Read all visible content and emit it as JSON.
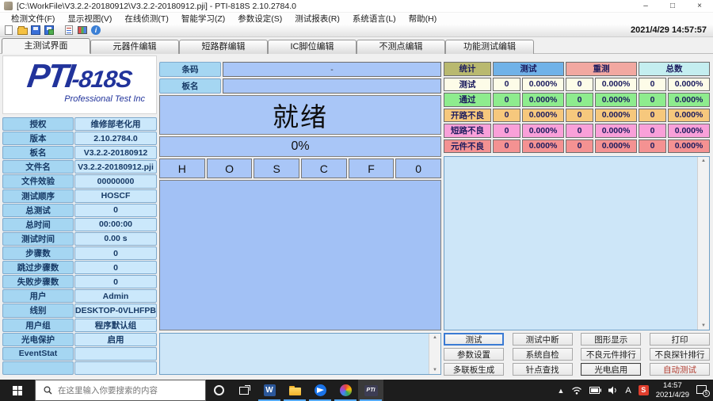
{
  "window": {
    "title": "[C:\\WorkFile\\V3.2.2-20180912\\V3.2.2-20180912.pji] - PTI-818S 2.10.2784.0",
    "controls": {
      "minimize": "–",
      "maximize": "□",
      "close": "×"
    }
  },
  "menu": {
    "items": [
      "检测文件(F)",
      "显示视图(V)",
      "在线侦测(T)",
      "智能学习(Z)",
      "参数设定(S)",
      "测试报表(R)",
      "系统语言(L)",
      "帮助(H)"
    ]
  },
  "toolbar": {
    "icons": [
      "new-file",
      "open-file",
      "save",
      "save-as",
      "report",
      "grid",
      "about"
    ],
    "datetime": "2021/4/29 14:57:57"
  },
  "tabs": [
    "主测试界面",
    "元器件编辑",
    "短路群编辑",
    "IC脚位编辑",
    "不测点编辑",
    "功能测试编辑"
  ],
  "logo": {
    "brand": "PTI",
    "model": "-818S",
    "subtitle": "Professional Test Inc"
  },
  "info_rows": [
    {
      "label": "授权",
      "value": "维修部老化用"
    },
    {
      "label": "版本",
      "value": "2.10.2784.0"
    },
    {
      "label": "板名",
      "value": "V3.2.2-20180912"
    },
    {
      "label": "文件名",
      "value": "V3.2.2-20180912.pji"
    },
    {
      "label": "文件效验",
      "value": "00000000"
    },
    {
      "label": "测试顺序",
      "value": "HOSCF"
    },
    {
      "label": "总测试",
      "value": "0"
    },
    {
      "label": "总时间",
      "value": "00:00:00"
    },
    {
      "label": "测试时间",
      "value": "0.00 s"
    },
    {
      "label": "步骤数",
      "value": "0"
    },
    {
      "label": "跳过步骤数",
      "value": "0"
    },
    {
      "label": "失败步骤数",
      "value": "0"
    },
    {
      "label": "用户",
      "value": "Admin"
    },
    {
      "label": "线别",
      "value": "DESKTOP-0VLHFPB"
    },
    {
      "label": "用户组",
      "value": "程序默认组"
    },
    {
      "label": "光电保护",
      "value": "启用"
    },
    {
      "label": "EventStat",
      "value": ""
    },
    {
      "label": "",
      "value": ""
    }
  ],
  "center": {
    "barcode_label": "条码",
    "barcode_value": "-",
    "board_label": "板名",
    "board_value": "",
    "status_text": "就绪",
    "progress_text": "0%",
    "test_sequence": [
      "H",
      "O",
      "S",
      "C",
      "F",
      "0"
    ]
  },
  "stats": {
    "corner_label": "统计",
    "corner_color": "#b9b96f",
    "groups": [
      {
        "label": "测试",
        "color": "#70b2e8"
      },
      {
        "label": "重测",
        "color": "#f2a8a1"
      },
      {
        "label": "总数",
        "color": "#c4eef0"
      }
    ],
    "rows": [
      {
        "label": "测试",
        "color": "#fdfce8",
        "cells": [
          "0",
          "0.000%",
          "0",
          "0.000%",
          "0",
          "0.000%"
        ]
      },
      {
        "label": "通过",
        "color": "#8eec8e",
        "cells": [
          "0",
          "0.000%",
          "0",
          "0.000%",
          "0",
          "0.000%"
        ]
      },
      {
        "label": "开路不良",
        "color": "#f6c87d",
        "cells": [
          "0",
          "0.000%",
          "0",
          "0.000%",
          "0",
          "0.000%"
        ]
      },
      {
        "label": "短路不良",
        "color": "#f9a0d9",
        "cells": [
          "0",
          "0.000%",
          "0",
          "0.000%",
          "0",
          "0.000%"
        ]
      },
      {
        "label": "元件不良",
        "color": "#f49292",
        "cells": [
          "0",
          "0.000%",
          "0",
          "0.000%",
          "0",
          "0.000%"
        ]
      }
    ]
  },
  "buttons": {
    "rows": [
      [
        "测试",
        "测试中断",
        "图形显示",
        "打印"
      ],
      [
        "参数设置",
        "系统自检",
        "不良元件排行",
        "不良探针排行"
      ],
      [
        "多联板生成",
        "针点查找",
        "光电启用",
        "自动测试"
      ]
    ],
    "autotest_bg": "#5254cf",
    "autotest_fg": "#b23b2e"
  },
  "taskbar": {
    "search_placeholder": "在这里输入你要搜索的内容",
    "apps": [
      "word",
      "file-explorer",
      "browser",
      "design-app",
      "pti-818s"
    ],
    "tray": {
      "input_indicator": "A",
      "ime_badge": "S",
      "time": "14:57",
      "date": "2021/4/29",
      "notification_count": "5"
    }
  },
  "colors": {
    "panel_label_blue": "#a5d6f2",
    "panel_value_blue": "#cbe8fb",
    "field_periwinkle": "#a9c6f7",
    "big_area_blue": "#a2c1f5",
    "log_light_blue": "#cde6f8",
    "focus_accent": "#3b7bd4",
    "taskbar_bg": "#1d1d1d",
    "running_indicator": "#55aaff"
  }
}
